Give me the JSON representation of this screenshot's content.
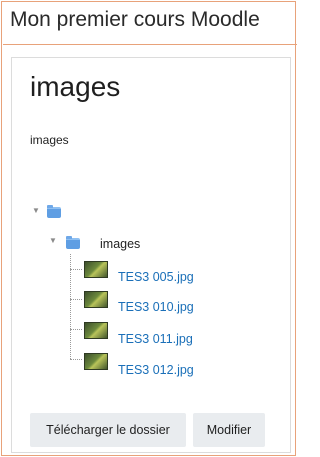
{
  "course": {
    "title": "Mon premier cours Moodle"
  },
  "page": {
    "heading": "images",
    "intro": "images"
  },
  "tree": {
    "root_folder_label": "",
    "folder": {
      "label": "images"
    },
    "files": [
      {
        "name": "TES3 005.jpg"
      },
      {
        "name": "TES3 010.jpg"
      },
      {
        "name": "TES3 011.jpg"
      },
      {
        "name": "TES3 012.jpg"
      }
    ]
  },
  "actions": {
    "download_label": "Télécharger le dossier",
    "edit_label": "Modifier"
  },
  "colors": {
    "accent_border": "#e8a27a",
    "link": "#1a6fb8",
    "folder": "#5f9ee3"
  },
  "icons": {
    "toggle": "triangle-down-icon",
    "folder": "folder-icon",
    "image": "image-thumbnail-icon"
  }
}
